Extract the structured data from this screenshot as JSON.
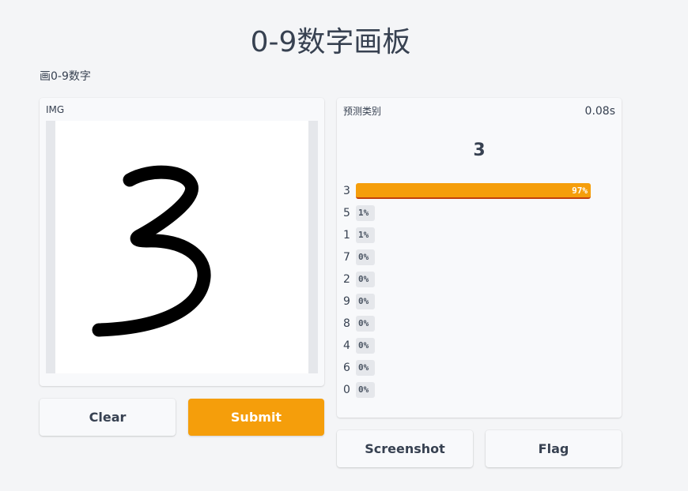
{
  "header": {
    "title": "0-9数字画板",
    "description": "画0-9数字"
  },
  "image_panel": {
    "label": "IMG",
    "drawn_digit_icon": "handwritten-3"
  },
  "buttons": {
    "clear": "Clear",
    "submit": "Submit",
    "screenshot": "Screenshot",
    "flag": "Flag"
  },
  "label_panel": {
    "label": "预测类别",
    "time": "0.08s",
    "top_class": "3",
    "confidences": [
      {
        "label": "3",
        "percent_text": "97%",
        "value": 0.97
      },
      {
        "label": "5",
        "percent_text": "1%",
        "value": 0.01
      },
      {
        "label": "1",
        "percent_text": "1%",
        "value": 0.01
      },
      {
        "label": "7",
        "percent_text": "0%",
        "value": 0.0
      },
      {
        "label": "2",
        "percent_text": "0%",
        "value": 0.0
      },
      {
        "label": "9",
        "percent_text": "0%",
        "value": 0.0
      },
      {
        "label": "8",
        "percent_text": "0%",
        "value": 0.0
      },
      {
        "label": "4",
        "percent_text": "0%",
        "value": 0.0
      },
      {
        "label": "6",
        "percent_text": "0%",
        "value": 0.0
      },
      {
        "label": "0",
        "percent_text": "0%",
        "value": 0.0
      }
    ]
  },
  "colors": {
    "accent": "#f59e0b",
    "background": "#f4f5f7",
    "panel": "#f8f9fb",
    "text": "#374151"
  }
}
